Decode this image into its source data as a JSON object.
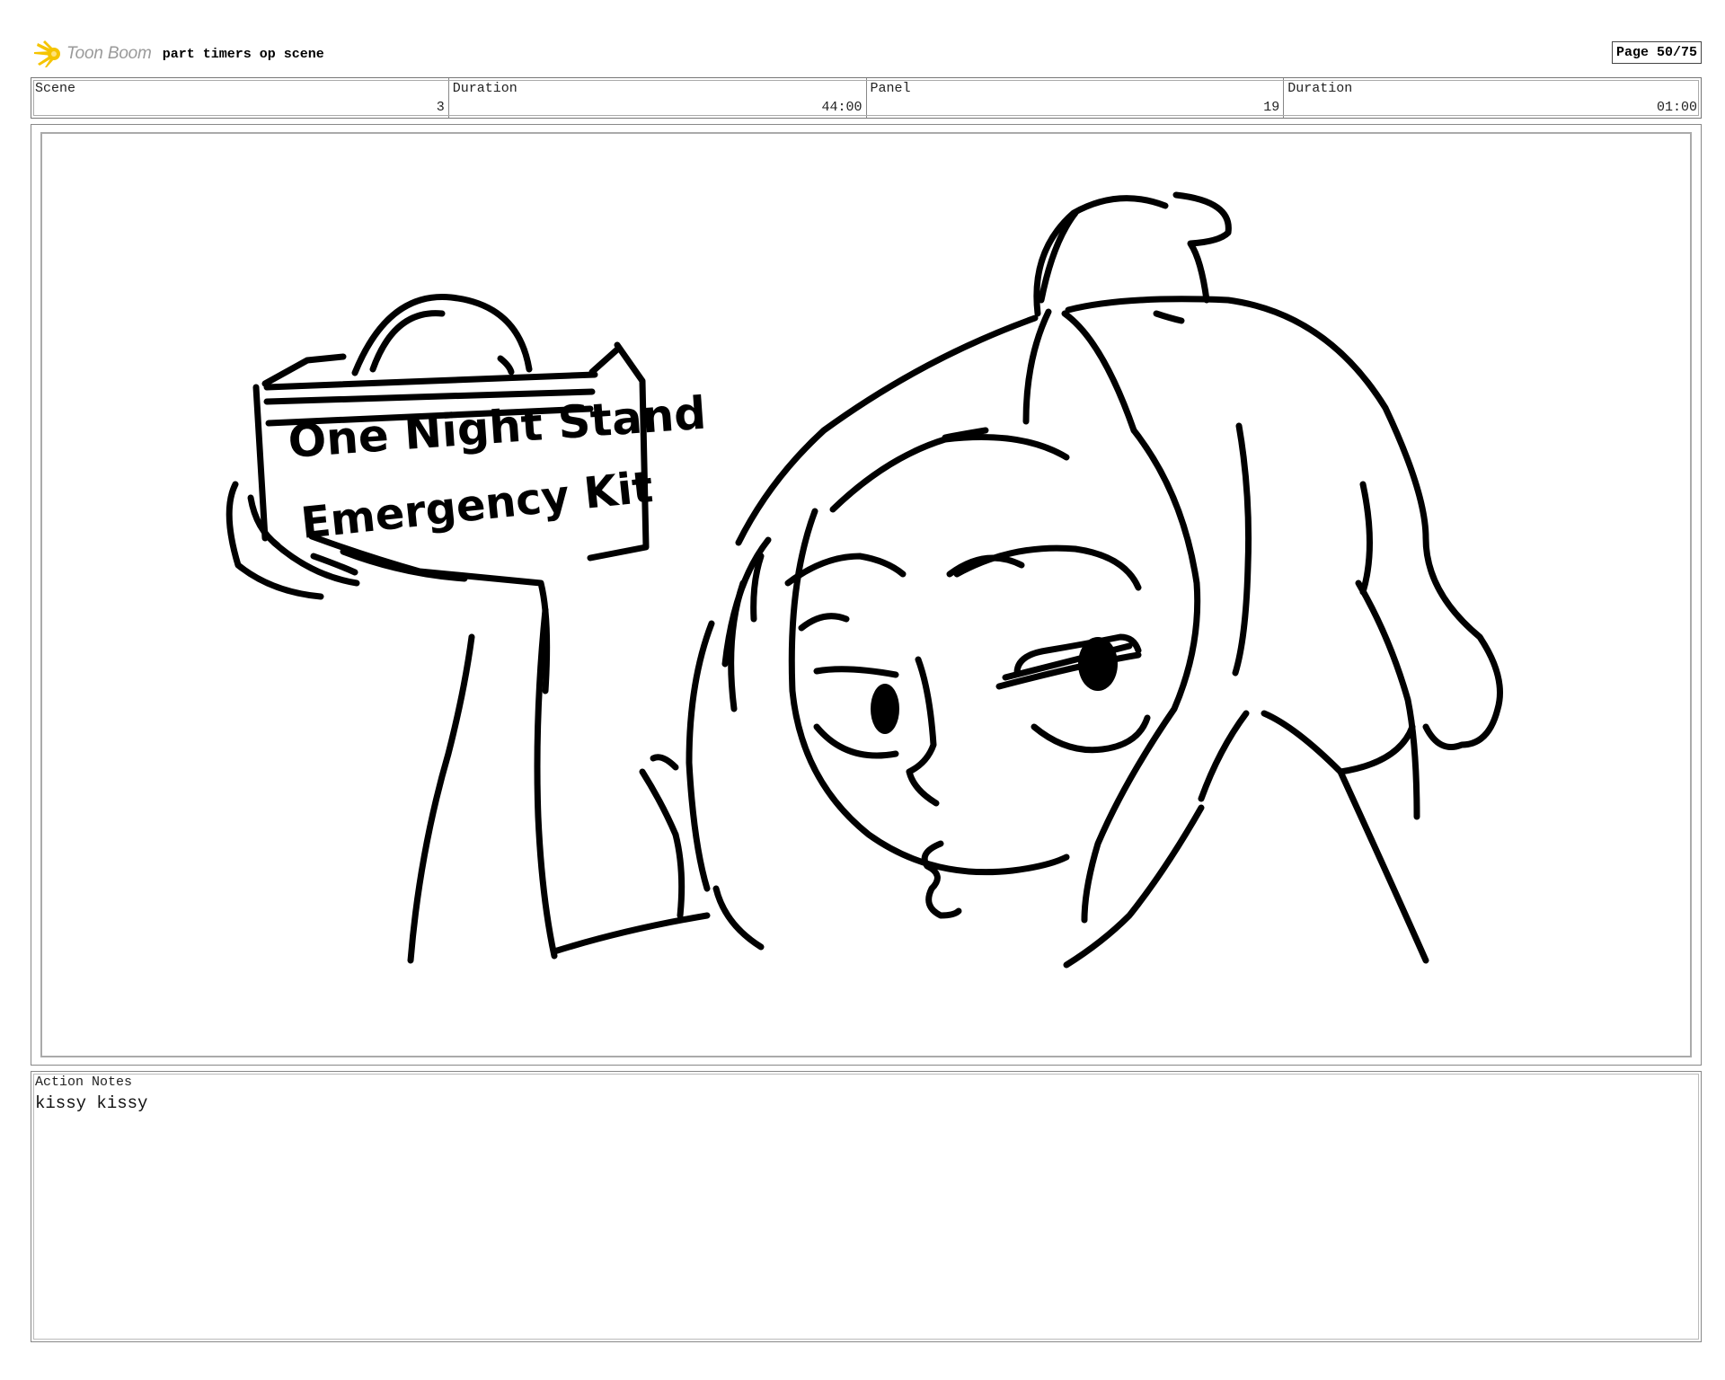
{
  "header": {
    "logo_text": "Toon Boom",
    "project_title": "part timers op scene",
    "page_label": "Page 50/75"
  },
  "info": [
    {
      "label": "Scene",
      "value": "3"
    },
    {
      "label": "Duration",
      "value": "44:00"
    },
    {
      "label": "Panel",
      "value": "19"
    },
    {
      "label": "Duration",
      "value": "01:00"
    }
  ],
  "panel": {
    "sign_line_1": "One Night Stand",
    "sign_line_2": "Emergency Kit"
  },
  "notes": {
    "label": "Action Notes",
    "text": "kissy kissy"
  },
  "colors": {
    "logo_accent": "#f5c400",
    "ink": "#000000"
  }
}
